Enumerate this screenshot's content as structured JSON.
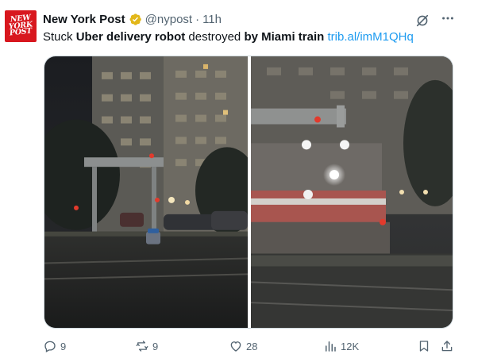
{
  "tweet": {
    "author": {
      "logo_lines": [
        "NEW",
        "YORK",
        "POST"
      ],
      "display_name": "New York Post",
      "handle": "@nypost",
      "separator": "·",
      "time": "11h"
    },
    "text": {
      "part1": "Stuck ",
      "part2": "Uber delivery robot",
      "part3": " destroyed ",
      "part4": "by Miami train",
      "part5": " ",
      "link": "trib.al/imM1QHq"
    },
    "actions": {
      "replies": "9",
      "reposts": "9",
      "likes": "28",
      "views": "12K"
    },
    "icons": {
      "verified": "verified-badge-icon",
      "grok": "grok-icon",
      "more": "more-icon",
      "reply": "reply-icon",
      "retweet": "retweet-icon",
      "like": "heart-icon",
      "views": "views-icon",
      "bookmark": "bookmark-icon",
      "share": "share-icon"
    },
    "colors": {
      "brand_red": "#d8171e",
      "verified_gold": "#e2b719",
      "link_blue": "#1d9bf0",
      "muted": "#536471"
    }
  }
}
